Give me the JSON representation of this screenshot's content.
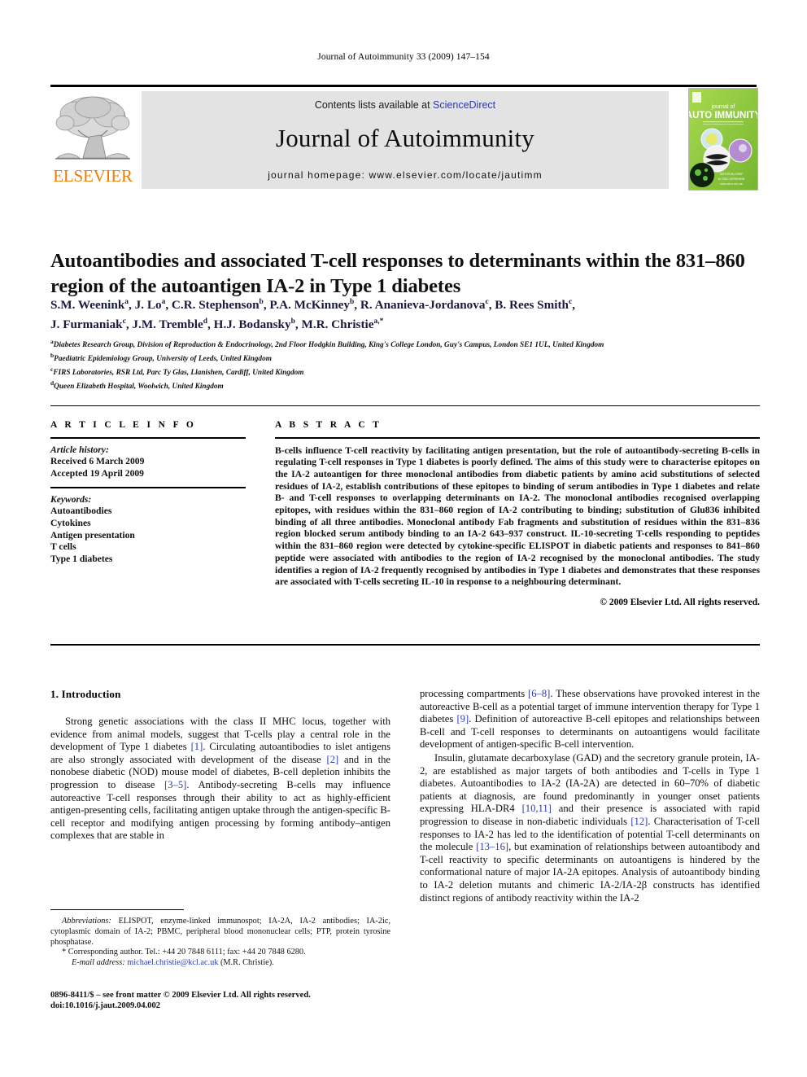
{
  "running_head": "Journal of Autoimmunity 33 (2009) 147–154",
  "masthead": {
    "contents_prefix": "Contents lists available at ",
    "sciencedirect": "ScienceDirect",
    "journal_name": "Journal of Autoimmunity",
    "homepage": "journal homepage: www.elsevier.com/locate/jautimm",
    "publisher": "ELSEVIER",
    "cover": {
      "line1": "journal of",
      "line2": "AUTO IMMUNITY",
      "tagline": "reviews · research · communications · clinical"
    },
    "colors": {
      "link": "#2b39b0",
      "elsevier_orange": "#F07D00",
      "banner_grey": "#e3e3e3",
      "cover_green": "#8dc63f"
    }
  },
  "article": {
    "title": "Autoantibodies and associated T-cell responses to determinants within the 831–860 region of the autoantigen IA-2 in Type 1 diabetes",
    "authors_line1": "S.M. Weenink a, J. Lo a, C.R. Stephenson b, P.A. McKinney b, R. Ananieva-Jordanova c, B. Rees Smith c,",
    "authors_line2": "J. Furmaniak c, J.M. Tremble d, H.J. Bodansky b, M.R. Christie a,*",
    "authors": [
      {
        "name": "S.M. Weenink",
        "sup": "a",
        "sep": ", "
      },
      {
        "name": "J. Lo",
        "sup": "a",
        "sep": ", "
      },
      {
        "name": "C.R. Stephenson",
        "sup": "b",
        "sep": ", "
      },
      {
        "name": "P.A. McKinney",
        "sup": "b",
        "sep": ", "
      },
      {
        "name": "R. Ananieva-Jordanova",
        "sup": "c",
        "sep": ", "
      },
      {
        "name": "B. Rees Smith",
        "sup": "c",
        "sep": ", "
      },
      {
        "name": "J. Furmaniak",
        "sup": "c",
        "sep": ", "
      },
      {
        "name": "J.M. Tremble",
        "sup": "d",
        "sep": ", "
      },
      {
        "name": "H.J. Bodansky",
        "sup": "b",
        "sep": ", "
      },
      {
        "name": "M.R. Christie",
        "sup": "a,*",
        "sep": ""
      }
    ],
    "affiliations": [
      {
        "marker": "a",
        "text": "Diabetes Research Group, Division of Reproduction & Endocrinology, 2nd Floor Hodgkin Building, King's College London, Guy's Campus, London SE1 1UL, United Kingdom"
      },
      {
        "marker": "b",
        "text": "Paediatric Epidemiology Group, University of Leeds, United Kingdom"
      },
      {
        "marker": "c",
        "text": "FIRS Laboratories, RSR Ltd, Parc Ty Glas, Llanishen, Cardiff, United Kingdom"
      },
      {
        "marker": "d",
        "text": "Queen Elizabeth Hospital, Woolwich, United Kingdom"
      }
    ]
  },
  "article_info": {
    "heading": "A R T I C L E  I N F O",
    "history_label": "Article history:",
    "received": "Received 6 March 2009",
    "accepted": "Accepted 19 April 2009",
    "keywords_label": "Keywords:",
    "keywords": [
      "Autoantibodies",
      "Cytokines",
      "Antigen presentation",
      "T cells",
      "Type 1 diabetes"
    ]
  },
  "abstract": {
    "heading": "A B S T R A C T",
    "text": "B-cells influence T-cell reactivity by facilitating antigen presentation, but the role of autoantibody-secreting B-cells in regulating T-cell responses in Type 1 diabetes is poorly defined. The aims of this study were to characterise epitopes on the IA-2 autoantigen for three monoclonal antibodies from diabetic patients by amino acid substitutions of selected residues of IA-2, establish contributions of these epitopes to binding of serum antibodies in Type 1 diabetes and relate B- and T-cell responses to overlapping determinants on IA-2. The monoclonal antibodies recognised overlapping epitopes, with residues within the 831–860 region of IA-2 contributing to binding; substitution of Glu836 inhibited binding of all three antibodies. Monoclonal antibody Fab fragments and substitution of residues within the 831–836 region blocked serum antibody binding to an IA-2 643–937 construct. IL-10-secreting T-cells responding to peptides within the 831–860 region were detected by cytokine-specific ELISPOT in diabetic patients and responses to 841–860 peptide were associated with antibodies to the region of IA-2 recognised by the monoclonal antibodies. The study identifies a region of IA-2 frequently recognised by antibodies in Type 1 diabetes and demonstrates that these responses are associated with T-cells secreting IL-10 in response to a neighbouring determinant.",
    "copyright": "© 2009 Elsevier Ltd. All rights reserved."
  },
  "body": {
    "section_number_title": "1.  Introduction",
    "left_paragraph_1": "Strong genetic associations with the class II MHC locus, together with evidence from animal models, suggest that T-cells play a central role in the development of Type 1 diabetes [1]. Circulating autoantibodies to islet antigens are also strongly associated with development of the disease [2] and in the nonobese diabetic (NOD) mouse model of diabetes, B-cell depletion inhibits the progression to disease [3–5]. Antibody-secreting B-cells may influence autoreactive T-cell responses through their ability to act as highly-efficient antigen-presenting cells, facilitating antigen uptake through the antigen-specific B-cell receptor and modifying antigen processing by forming antibody–antigen complexes that are stable in",
    "right_paragraph_1": "processing compartments [6–8]. These observations have provoked interest in the autoreactive B-cell as a potential target of immune intervention therapy for Type 1 diabetes [9]. Definition of autoreactive B-cell epitopes and relationships between B-cell and T-cell responses to determinants on autoantigens would facilitate development of antigen-specific B-cell intervention.",
    "right_paragraph_2": "Insulin, glutamate decarboxylase (GAD) and the secretory granule protein, IA-2, are established as major targets of both antibodies and T-cells in Type 1 diabetes. Autoantibodies to IA-2 (IA-2A) are detected in 60–70% of diabetic patients at diagnosis, are found predominantly in younger onset patients expressing HLA-DR4 [10,11] and their presence is associated with rapid progression to disease in non-diabetic individuals [12]. Characterisation of T-cell responses to IA-2 has led to the identification of potential T-cell determinants on the molecule [13–16], but examination of relationships between autoantibody and T-cell reactivity to specific determinants on autoantigens is hindered by the conformational nature of major IA-2A epitopes. Analysis of autoantibody binding to IA-2 deletion mutants and chimeric IA-2/IA-2β constructs has identified distinct regions of antibody reactivity within the IA-2"
  },
  "footnotes": {
    "abbreviations_label": "Abbreviations:",
    "abbreviations_text": "ELISPOT, enzyme-linked immunospot; IA-2A, IA-2 antibodies; IA-2ic, cytoplasmic domain of IA-2; PBMC, peripheral blood mononuclear cells; PTP, protein tyrosine phosphatase.",
    "corresponding": "* Corresponding author. Tel.: +44 20 7848 6111; fax: +44 20 7848 6280.",
    "email_label": "E-mail address:",
    "email": "michael.christie@kcl.ac.uk",
    "email_suffix": "(M.R. Christie)."
  },
  "imprint": {
    "line1": "0896-8411/$ – see front matter © 2009 Elsevier Ltd. All rights reserved.",
    "line2": "doi:10.1016/j.jaut.2009.04.002"
  }
}
